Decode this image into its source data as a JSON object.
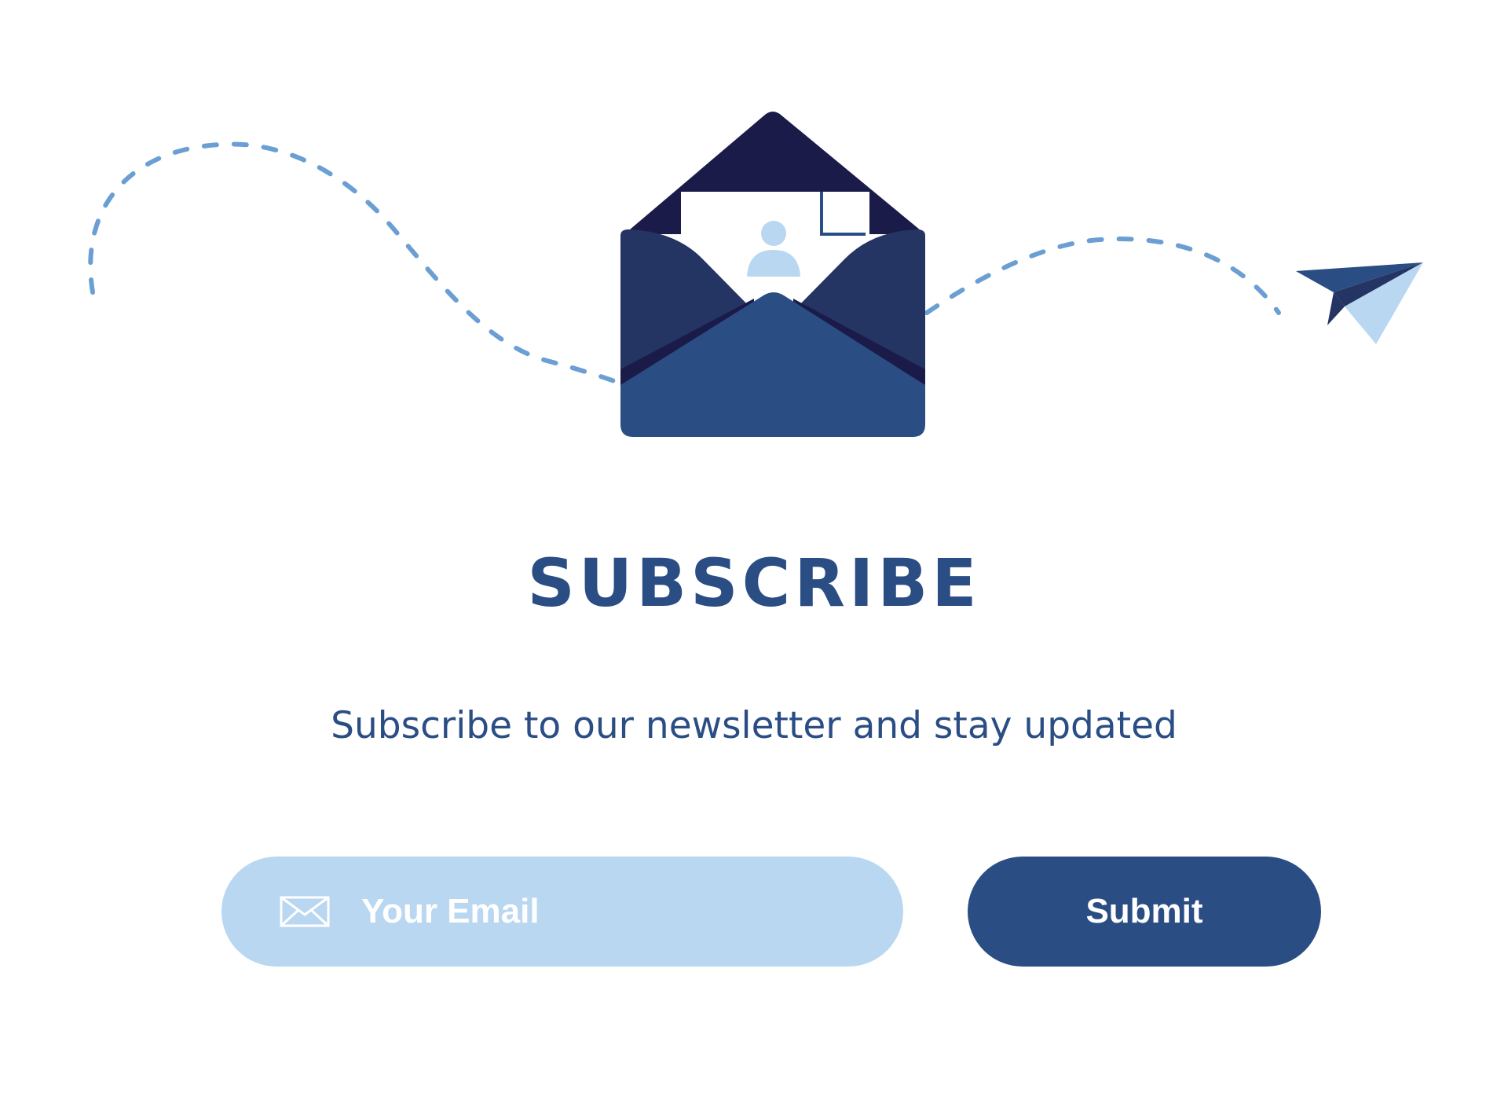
{
  "header": {
    "title": "SUBSCRIBE",
    "subtitle": "Subscribe to our newsletter and stay updated"
  },
  "form": {
    "email_placeholder": "Your Email",
    "email_value": "",
    "submit_label": "Submit"
  },
  "icons": {
    "envelope": "envelope-open-icon",
    "paper_plane": "paper-plane-icon",
    "user": "user-icon",
    "mail": "mail-icon"
  },
  "colors": {
    "primary": "#2a4d84",
    "dark": "#1b1b4a",
    "mid": "#243463",
    "light": "#b9d7f1",
    "dash": "#6b9fd4",
    "background": "#ffffff"
  }
}
